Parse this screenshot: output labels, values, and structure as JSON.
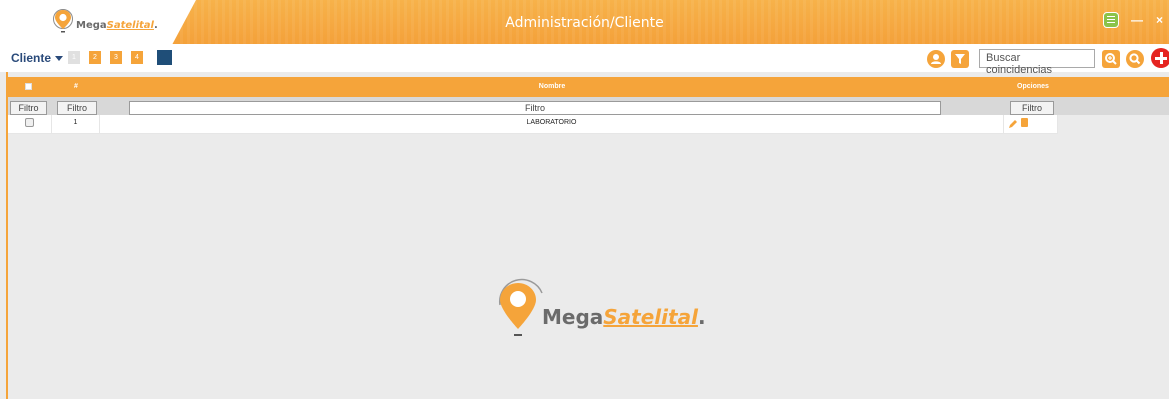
{
  "window": {
    "title": "Administración/Cliente",
    "brand_part1": "Mega",
    "brand_part2": "Satelital",
    "brand_dot": ".",
    "minimize_label": "—",
    "close_label": "×"
  },
  "toolbar": {
    "menu_label": "Cliente",
    "pages": [
      "1",
      "2",
      "3",
      "4"
    ],
    "search_placeholder": "Buscar coincidencias"
  },
  "grid": {
    "columns": {
      "check": "",
      "num": "#",
      "name": "Nombre",
      "options": "Opciones"
    },
    "filters": {
      "check": "Filtro",
      "num": "Filtro",
      "name": "Filtro",
      "options": "Filtro"
    },
    "rows": [
      {
        "num": "1",
        "name": "LABORATORIO"
      }
    ]
  },
  "colors": {
    "accent": "#f5a43a",
    "dark_blue": "#1f4e78",
    "add_red": "#e52421"
  },
  "icons": [
    "logo-pin-icon",
    "user-icon",
    "filter-icon",
    "zoom-icon",
    "search-icon",
    "add-icon",
    "edit-icon",
    "delete-icon",
    "app-icon"
  ]
}
